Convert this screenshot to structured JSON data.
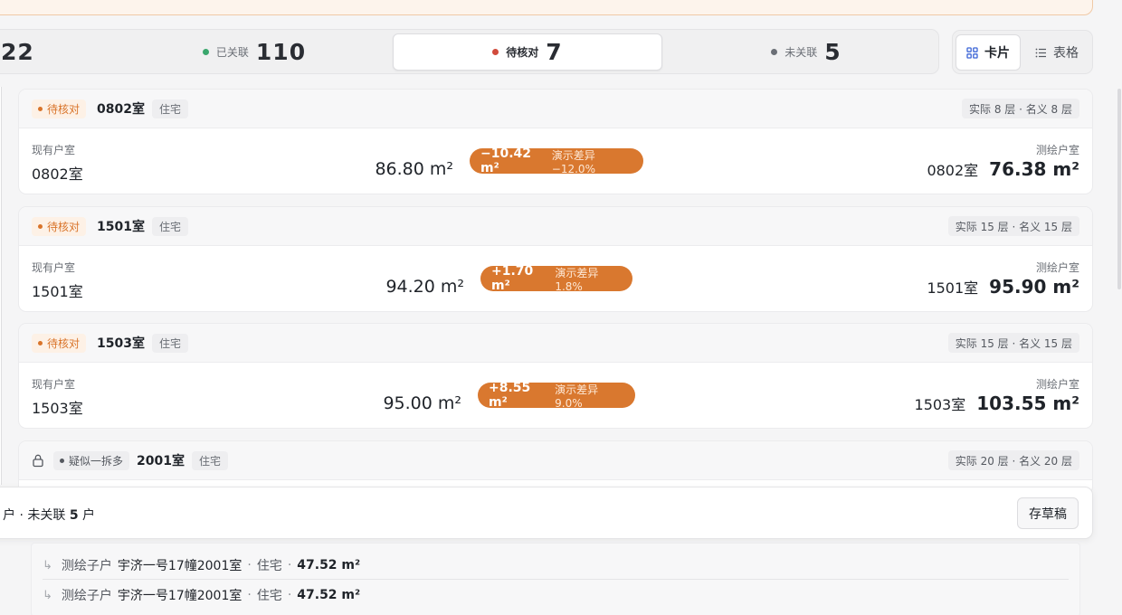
{
  "stats": {
    "total_partial": "22",
    "linked": {
      "label": "已关联",
      "count": "110",
      "color": "#3aa76d"
    },
    "pending": {
      "label": "待核对",
      "count": "7",
      "color": "#d14b3c"
    },
    "unlinked": {
      "label": "未关联",
      "count": "5",
      "color": "#6b6f76"
    }
  },
  "view": {
    "card_label": "卡片",
    "table_label": "表格",
    "active": "card"
  },
  "cards": [
    {
      "status": "待核对",
      "room": "0802室",
      "type": "住宅",
      "floor": "实际 8 层 · 名义 8 层",
      "current_label": "现有户室",
      "current_room": "0802室",
      "current_area": "86.80 m²",
      "diff_value": "−10.42 m²",
      "diff_text": "演示差异 −12.0%",
      "survey_label": "测绘户室",
      "survey_room": "0802室",
      "survey_area": "76.38 m²"
    },
    {
      "status": "待核对",
      "room": "1501室",
      "type": "住宅",
      "floor": "实际 15 层 · 名义 15 层",
      "current_label": "现有户室",
      "current_room": "1501室",
      "current_area": "94.20 m²",
      "diff_value": "+1.70 m²",
      "diff_text": "演示差异 1.8%",
      "survey_label": "测绘户室",
      "survey_room": "1501室",
      "survey_area": "95.90 m²"
    },
    {
      "status": "待核对",
      "room": "1503室",
      "type": "住宅",
      "floor": "实际 15 层 · 名义 15 层",
      "current_label": "现有户室",
      "current_room": "1503室",
      "current_area": "95.00 m²",
      "diff_value": "+8.55 m²",
      "diff_text": "演示差异 9.0%",
      "survey_label": "测绘户室",
      "survey_room": "1503室",
      "survey_area": "103.55 m²"
    },
    {
      "status": "疑似一拆多",
      "room": "2001室",
      "type": "住宅",
      "floor": "实际 20 层 · 名义 20 层"
    }
  ],
  "footer": {
    "prefix": "户 · 未关联 ",
    "count": "5",
    "suffix": " 户",
    "draft_label": "存草稿"
  },
  "children": [
    {
      "label": "测绘子户",
      "name": "宇济一号17幢2001室",
      "type": "住宅",
      "area": "47.52 m²"
    },
    {
      "label": "测绘子户",
      "name": "宇济一号17幢2001室",
      "type": "住宅",
      "area": "47.52 m²"
    }
  ]
}
